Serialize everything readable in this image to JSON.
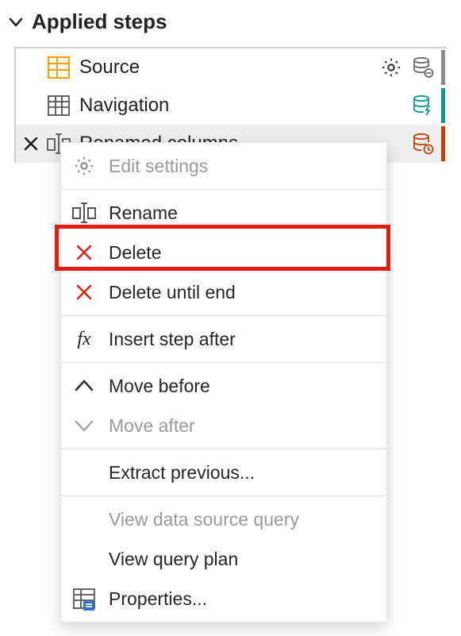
{
  "panel": {
    "title": "Applied steps"
  },
  "steps": [
    {
      "label": "Source"
    },
    {
      "label": "Navigation"
    },
    {
      "label": "Renamed columns"
    }
  ],
  "context_menu": {
    "edit_settings": "Edit settings",
    "rename": "Rename",
    "delete": "Delete",
    "delete_until_end": "Delete until end",
    "insert_step_after": "Insert step after",
    "move_before": "Move before",
    "move_after": "Move after",
    "extract_previous": "Extract previous...",
    "view_data_source_query": "View data source query",
    "view_query_plan": "View query plan",
    "properties": "Properties..."
  },
  "colors": {
    "accent_orange": "#f2a100",
    "delete_red": "#e11d0f",
    "teal": "#0b9a8e",
    "db_orange": "#c2410c",
    "gray": "#8a8a8a"
  }
}
